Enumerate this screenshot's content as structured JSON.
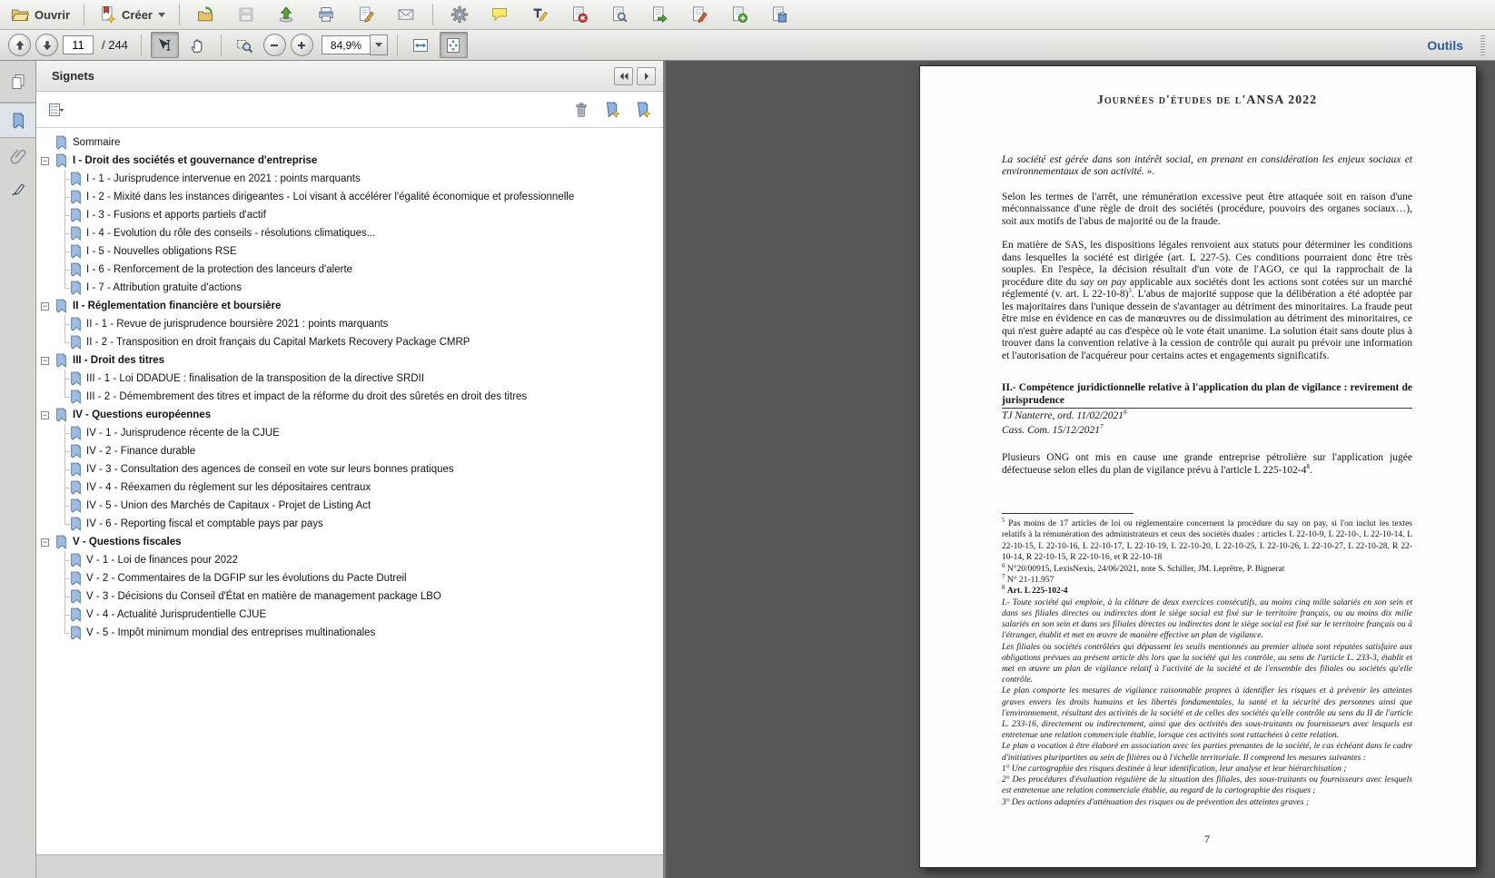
{
  "toolbar": {
    "open_label": "Ouvrir",
    "create_label": "Créer",
    "icon_buttons": [
      "folder-open-icon",
      "create-document-icon",
      "import-convert-icon",
      "save-icon",
      "share-upload-icon",
      "print-icon",
      "sign-icon",
      "email-icon",
      "settings-gear-icon",
      "comment-icon",
      "typewriter-icon",
      "delete-pages-icon",
      "replace-pages-icon",
      "export-pages-icon",
      "edit-pages-icon",
      "insert-pages-icon",
      "header-footer-icon"
    ]
  },
  "nav": {
    "page_value": "11",
    "page_total_label": "/ 244",
    "zoom_value": "84,9%",
    "tools_label": "Outils"
  },
  "sidebar": {
    "panel_title": "Signets",
    "nav_icons": [
      "pages-thumbnails-icon",
      "bookmarks-icon",
      "attachments-paperclip-icon",
      "signature-icon"
    ],
    "panel_tool_icons": [
      "options-list-icon",
      "trash-icon",
      "new-bookmark-icon",
      "new-child-bookmark-icon"
    ]
  },
  "bookmarks": {
    "items": [
      {
        "label": "Sommaire",
        "level": 0,
        "expandable": false,
        "last": false
      },
      {
        "label": "I - Droit des sociétés et gouvernance d'entreprise",
        "level": 0,
        "expandable": true,
        "last": false
      },
      {
        "label": "I - 1 - Jurisprudence intervenue en 2021 : points marquants",
        "level": 1,
        "expandable": false,
        "last": false
      },
      {
        "label": "I - 2 - Mixité dans les instances dirigeantes - Loi visant à accélérer l'égalité économique et professionnelle",
        "level": 1,
        "expandable": false,
        "last": false
      },
      {
        "label": "I - 3 - Fusions et apports partiels d'actif",
        "level": 1,
        "expandable": false,
        "last": false
      },
      {
        "label": "I - 4 - Evolution du rôle des conseils - résolutions climatiques...",
        "level": 1,
        "expandable": false,
        "last": false
      },
      {
        "label": "I - 5 - Nouvelles obligations RSE",
        "level": 1,
        "expandable": false,
        "last": false
      },
      {
        "label": "I - 6 - Renforcement de la protection des lanceurs d'alerte",
        "level": 1,
        "expandable": false,
        "last": false
      },
      {
        "label": "I - 7 - Attribution gratuite d'actions",
        "level": 1,
        "expandable": false,
        "last": true
      },
      {
        "label": "II - Réglementation financière et boursière",
        "level": 0,
        "expandable": true,
        "last": false
      },
      {
        "label": "II - 1 - Revue de jurisprudence boursière 2021 : points marquants",
        "level": 1,
        "expandable": false,
        "last": false
      },
      {
        "label": "II - 2 - Transposition en droit français du Capital Markets Recovery Package CMRP",
        "level": 1,
        "expandable": false,
        "last": true
      },
      {
        "label": "III - Droit des titres",
        "level": 0,
        "expandable": true,
        "last": false
      },
      {
        "label": "III - 1 - Loi DDADUE : finalisation de la transposition de la directive SRDII",
        "level": 1,
        "expandable": false,
        "last": false
      },
      {
        "label": "III - 2 - Démembrement des titres et impact de la réforme du droit des sûretés en droit des titres",
        "level": 1,
        "expandable": false,
        "last": true
      },
      {
        "label": "IV - Questions européennes",
        "level": 0,
        "expandable": true,
        "last": false
      },
      {
        "label": "IV - 1 - Jurisprudence récente de la CJUE",
        "level": 1,
        "expandable": false,
        "last": false
      },
      {
        "label": "IV - 2 - Finance durable",
        "level": 1,
        "expandable": false,
        "last": false
      },
      {
        "label": "IV - 3 - Consultation des agences de conseil en vote sur leurs bonnes pratiques",
        "level": 1,
        "expandable": false,
        "last": false
      },
      {
        "label": "IV - 4 - Réexamen du règlement sur les dépositaires centraux",
        "level": 1,
        "expandable": false,
        "last": false
      },
      {
        "label": "IV - 5 - Union des Marchés de Capitaux - Projet de Listing Act",
        "level": 1,
        "expandable": false,
        "last": false
      },
      {
        "label": "IV - 6 - Reporting fiscal et comptable pays par pays",
        "level": 1,
        "expandable": false,
        "last": true
      },
      {
        "label": "V - Questions fiscales",
        "level": 0,
        "expandable": true,
        "last": false
      },
      {
        "label": "V - 1 - Loi de finances pour 2022",
        "level": 1,
        "expandable": false,
        "last": false
      },
      {
        "label": "V - 2 - Commentaires de la DGFIP sur les évolutions du Pacte Dutreil",
        "level": 1,
        "expandable": false,
        "last": false
      },
      {
        "label": "V - 3 - Décisions du Conseil d'État en matière de management package LBO",
        "level": 1,
        "expandable": false,
        "last": false
      },
      {
        "label": "V - 4 - Actualité Jurisprudentielle CJUE",
        "level": 1,
        "expandable": false,
        "last": false
      },
      {
        "label": "V - 5 - Impôt minimum mondial des entreprises multinationales",
        "level": 1,
        "expandable": false,
        "last": true
      }
    ]
  },
  "page": {
    "title": "Journées d'études de l'ANSA 2022",
    "quote": [
      {
        "t": "La société est gérée dans son intérêt social, en prenant en considération les enjeux sociaux et environnementaux de son activité. ».",
        "s": "i"
      }
    ],
    "para1": [
      {
        "t": "Selon les termes de l'arrêt, une rémunération excessive peut être attaquée soit en raison d'une méconnaissance d'une règle de droit des sociétés (procédure, pouvoirs des organes sociaux…), soit aux motifs de l'abus de majorité ou de la fraude.",
        "s": ""
      }
    ],
    "para2": [
      {
        "t": "En matière de SAS, les dispositions légales renvoient aux statuts pour déterminer les conditions dans lesquelles la société est dirigée (art. L 227-5). Ces conditions pourraient donc être très souples. En l'espèce, la décision résultait d'un vote de l'AGO, ce qui la rapprochait de la procédure dite du ",
        "s": ""
      },
      {
        "t": "say on pay",
        "s": "i"
      },
      {
        "t": " applicable aux sociétés dont les actions sont cotées sur un marché réglementé (v. art. L 22-10-8)",
        "s": ""
      },
      {
        "t": "5",
        "s": "sup"
      },
      {
        "t": ". L'abus de majorité suppose que la délibération a été adoptée par les majoritaires dans l'unique dessein de s'avantager au détriment des minoritaires. La fraude peut être mise en évidence en cas de manœuvres ou de dissimulation au détriment des minoritaires, ce qui n'est guère adapté au cas d'espèce où le vote était unanime. La solution était sans doute plus à trouver dans la convention relative à la cession de contrôle qui aurait pu prévoir une information et l'autorisation de l'acquéreur pour certains actes et engagements significatifs.",
        "s": ""
      }
    ],
    "heading2": "II.- Compétence juridictionnelle relative à l'application du plan de vigilance : revirement de jurisprudence",
    "refs": [
      [
        {
          "t": "TJ Nanterre, ord. 11/02/2021",
          "s": "i"
        },
        {
          "t": "6",
          "s": "sup"
        }
      ],
      [
        {
          "t": "Cass. Com. 15/12/2021",
          "s": "i"
        },
        {
          "t": "7",
          "s": "sup"
        }
      ]
    ],
    "para3": [
      {
        "t": "Plusieurs ONG ont mis en cause une grande entreprise pétrolière sur l'application jugée défectueuse selon elles du plan de vigilance prévu à l'article L 225-102-4",
        "s": ""
      },
      {
        "t": "8",
        "s": "sup"
      },
      {
        "t": ".",
        "s": ""
      }
    ],
    "footnotes": [
      {
        "num": "5",
        "segs": [
          {
            "t": "Pas moins de 17 articles de loi ou réglementaire concernent la procédure du say on pay, si l'on inclut les textes relatifs à la rémunération des administrateurs et ceux des sociétés duales : articles L 22-10-9, L 22-10-, L 22-10-14, L 22-10-15, L 22-10-16, L 22-10-17, L 22-10-19, L 22-10-20, L 22-10-25, L 22-10-26, L 22-10-27, L 22-10-28, R 22-10-14, R 22-10-15, R 22-10-16, et R 22-10-18",
            "s": ""
          }
        ]
      },
      {
        "num": "6",
        "segs": [
          {
            "t": "N°20/00915, LexisNexis, 24/06/2021, note S. Schiller, JM. Leprêtre, P. Bignerat",
            "s": ""
          }
        ]
      },
      {
        "num": "7",
        "segs": [
          {
            "t": "N° 21-11.957",
            "s": ""
          }
        ]
      },
      {
        "num": "8",
        "segs": [
          {
            "t": "Art. L 225-102-4",
            "s": "b"
          }
        ]
      }
    ],
    "footnote8_lines": [
      "I.- Toute société qui emploie, à la clôture de deux exercices consécutifs, au moins cinq mille salariés en son sein et dans ses filiales directes ou indirectes dont le siège social est fixé sur le territoire français, ou au moins dix mille salariés en son sein et dans ses filiales directes ou indirectes dont le siège social est fixé sur le territoire français ou à l'étranger, établit et met en œuvre de manière effective un plan de vigilance.",
      "Les filiales ou sociétés contrôlées qui dépassent les seuils mentionnés au premier alinéa sont réputées satisfaire aux obligations prévues au présent article dès lors que la société qui les contrôle, au sens de l'article L. 233-3, établit et met en œuvre un plan de vigilance relatif à l'activité de la société et de l'ensemble des filiales ou sociétés qu'elle contrôle.",
      "Le plan comporte les mesures de vigilance raisonnable propres à identifier les risques et à prévenir les atteintes graves envers les droits humains et les libertés fondamentales, la santé et la sécurité des personnes ainsi que l'environnement, résultant des activités de la société et de celles des sociétés qu'elle contrôle au sens du II de l'article L. 233-16, directement ou indirectement, ainsi que des activités des sous-traitants ou fournisseurs avec lesquels est entretenue une relation commerciale établie, lorsque ces activités sont rattachées à cette relation.",
      "Le plan a vocation à être élaboré en association avec les parties prenantes de la société, le cas échéant dans le cadre d'initiatives pluripartites au sein de filières ou à l'échelle territoriale. Il comprend les mesures suivantes :",
      "1° Une cartographie des risques destinée à leur identification, leur analyse et leur hiérarchisation ;",
      "2° Des procédures d'évaluation régulière de la situation des filiales, des sous-traitants ou fournisseurs avec lesquels est entretenue une relation commerciale établie, au regard de la cartographie des risques ;",
      "3° Des actions adaptées d'atténuation des risques ou de prévention des atteintes graves ;"
    ],
    "page_number": "7"
  },
  "colors": {
    "accent_blue": "#2a5d9c",
    "bookmark_blue": "#9dbde4",
    "doc_background": "#575757",
    "toolbar_gray": "#e8e8e6"
  }
}
